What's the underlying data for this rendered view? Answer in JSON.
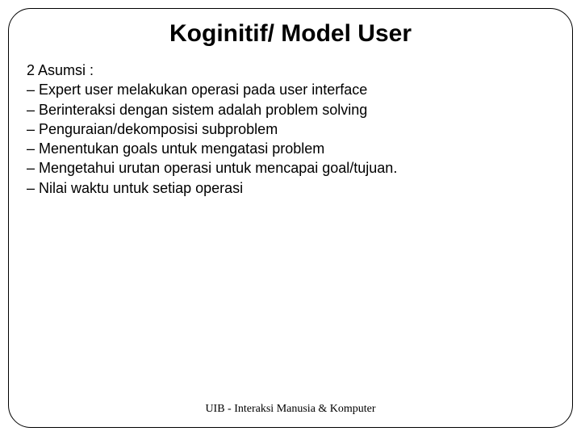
{
  "title": "Koginitif/ Model User",
  "intro": "2 Asumsi :",
  "bullets": [
    "– Expert user melakukan operasi pada user interface",
    "– Berinteraksi dengan sistem adalah problem solving",
    "– Penguraian/dekomposisi subproblem",
    "– Menentukan goals untuk mengatasi problem",
    "– Mengetahui urutan operasi untuk mencapai goal/tujuan.",
    "– Nilai waktu untuk setiap operasi"
  ],
  "footer": "UIB - Interaksi Manusia & Komputer"
}
